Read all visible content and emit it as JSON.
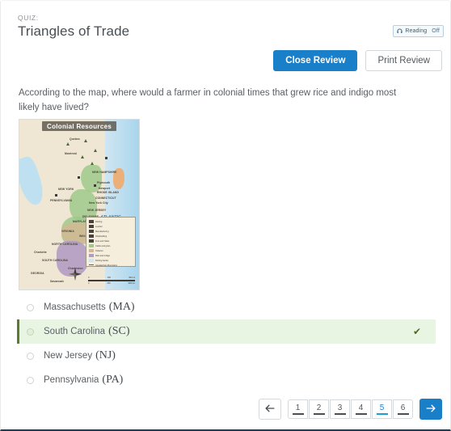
{
  "header": {
    "kicker": "QUIZ:",
    "title": "Triangles of Trade",
    "reading_badge": {
      "icon": "headphones-icon",
      "label": "Reading",
      "state": "Off"
    },
    "close_review_label": "Close Review",
    "print_review_label": "Print Review"
  },
  "question": {
    "text": "According to the map, where would a farmer in colonial times that grew rice and indigo most likely have lived?"
  },
  "map": {
    "title": "Colonial Resources",
    "ocean_label": "ATLANTIC OCEAN",
    "place_labels": [
      "Quebec",
      "Montreal",
      "NEW HAMPSHIRE",
      "Boston",
      "MASS.",
      "Plymouth",
      "Newport",
      "RHODE ISLAND",
      "CONNECTICUT",
      "NEW YORK",
      "New York City",
      "PENNSYLVANIA",
      "NEW JERSEY",
      "Philadelphia",
      "DELAWARE",
      "MARYLAND",
      "VIRGINIA",
      "Williamsburg",
      "NORTH CAROLINA",
      "Charlotte",
      "SOUTH CAROLINA",
      "Charleston",
      "GEORGIA",
      "Savannah"
    ],
    "legend": [
      {
        "label": "Fishing",
        "color": "#4a4238"
      },
      {
        "label": "Lumber",
        "color": "#4a4238"
      },
      {
        "label": "Manufacturing",
        "color": "#4a4238"
      },
      {
        "label": "Shipbuilding",
        "color": "#4a4238"
      },
      {
        "label": "Furs and hides",
        "color": "#4a4238"
      },
      {
        "label": "Cattle and grain",
        "color": "#9dc98a"
      },
      {
        "label": "Tobacco",
        "color": "#d3b793"
      },
      {
        "label": "Rice and indigo",
        "color": "#b29cc4"
      },
      {
        "label": "Fishing banks",
        "color": "#cfe6f2"
      },
      {
        "label": "Appalachian Mountains",
        "color": "#8a7f6c"
      }
    ],
    "scale": {
      "miles": [
        "0",
        "150",
        "300 mi"
      ],
      "km": [
        "0",
        "150",
        "300 km"
      ]
    }
  },
  "options": [
    {
      "label": "Massachusetts",
      "abbr": "(MA)",
      "correct": false
    },
    {
      "label": "South Carolina",
      "abbr": "(SC)",
      "correct": true
    },
    {
      "label": "New Jersey",
      "abbr": "(NJ)",
      "correct": false
    },
    {
      "label": "Pennsylvania",
      "abbr": "(PA)",
      "correct": false
    }
  ],
  "correct_mark": "✔",
  "pagination": {
    "prev_icon": "arrow-left-icon",
    "next_icon": "arrow-right-icon",
    "pages": [
      "1",
      "2",
      "3",
      "4",
      "5",
      "6"
    ],
    "active_page": "5"
  },
  "colors": {
    "primary_blue": "#1a7fc9",
    "active_underline": "#1a9fd4",
    "correct_bg": "#e9f5e3",
    "correct_border": "#5d7a2e",
    "check_green": "#4d6b25",
    "footer_rule": "#1d3c5a"
  }
}
